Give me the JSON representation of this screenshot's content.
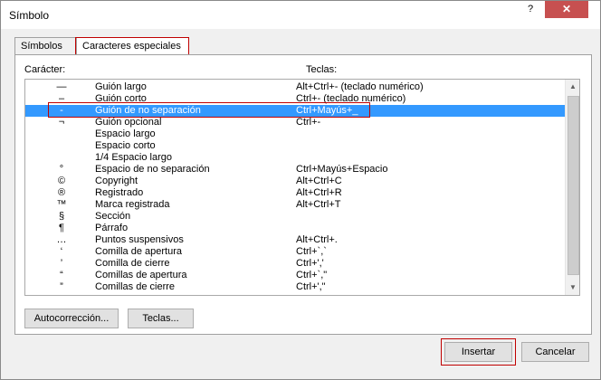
{
  "window": {
    "title": "Símbolo",
    "help_glyph": "?",
    "close_glyph": "✕"
  },
  "tabs": [
    {
      "label": "Símbolos",
      "active": false
    },
    {
      "label": "Caracteres especiales",
      "active": true
    }
  ],
  "columns": {
    "character": "Carácter:",
    "keys": "Teclas:"
  },
  "rows": [
    {
      "char": "—",
      "name": "Guión largo",
      "keys": "Alt+Ctrl+- (teclado numérico)"
    },
    {
      "char": "–",
      "name": "Guión corto",
      "keys": "Ctrl+- (teclado numérico)"
    },
    {
      "char": "‑",
      "name": "Guión de no separación",
      "keys": "Ctrl+Mayús+_",
      "selected": true
    },
    {
      "char": "¬",
      "name": "Guión opcional",
      "keys": "Ctrl+-"
    },
    {
      "char": "",
      "name": "Espacio largo",
      "keys": ""
    },
    {
      "char": "",
      "name": "Espacio corto",
      "keys": ""
    },
    {
      "char": "",
      "name": "1/4 Espacio largo",
      "keys": ""
    },
    {
      "char": "°",
      "name": "Espacio de no separación",
      "keys": "Ctrl+Mayús+Espacio"
    },
    {
      "char": "©",
      "name": "Copyright",
      "keys": "Alt+Ctrl+C"
    },
    {
      "char": "®",
      "name": "Registrado",
      "keys": "Alt+Ctrl+R"
    },
    {
      "char": "™",
      "name": "Marca registrada",
      "keys": "Alt+Ctrl+T"
    },
    {
      "char": "§",
      "name": "Sección",
      "keys": ""
    },
    {
      "char": "¶",
      "name": "Párrafo",
      "keys": ""
    },
    {
      "char": "…",
      "name": "Puntos suspensivos",
      "keys": "Alt+Ctrl+."
    },
    {
      "char": "‘",
      "name": "Comilla de apertura",
      "keys": "Ctrl+`,`"
    },
    {
      "char": "’",
      "name": "Comilla de cierre",
      "keys": "Ctrl+','"
    },
    {
      "char": "“",
      "name": "Comillas de apertura",
      "keys": "Ctrl+`,\""
    },
    {
      "char": "”",
      "name": "Comillas de cierre",
      "keys": "Ctrl+',\""
    }
  ],
  "scroll": {
    "up_icon": "scroll-up-arrow",
    "down_icon": "scroll-down-arrow",
    "up_glyph": "▲",
    "down_glyph": "▼"
  },
  "buttons": {
    "autocorrect": "Autocorrección...",
    "keys": "Teclas...",
    "insert": "Insertar",
    "cancel": "Cancelar"
  },
  "colors": {
    "selection": "#3399ff",
    "highlight_outline": "#c00000",
    "close_button": "#c75050"
  }
}
